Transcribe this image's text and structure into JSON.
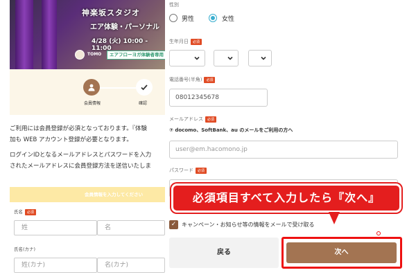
{
  "hero": {
    "studio": "神楽坂スタジオ",
    "kind": "エア体験・パーソナル",
    "when": "4/28 (火) 10:00 - 11:00",
    "instructor": "TOMO",
    "badge": "エアフローヨガ体験者専用"
  },
  "steps": [
    {
      "label": "会員情報",
      "icon": "person-icon"
    },
    {
      "label": "確認",
      "icon": "check-icon"
    }
  ],
  "intro": {
    "p1_line1": "ご利用には会員登録が必須となっております。『体験",
    "p1_line2": "加も WEB アカウント登録が必要となります。",
    "p2_line1": "ログインIDとなるメールアドレスとパスワードを入力",
    "p2_line2": "されたメールアドレスに会員登録方法を送信いたしま"
  },
  "left_form": {
    "section_title": "会員情報を入力してください",
    "name_label": "氏名",
    "required": "必須",
    "last_name_placeholder": "姓",
    "first_name_placeholder": "名",
    "kana_label": "氏名(カナ)",
    "last_kana_placeholder": "姓(カナ)",
    "first_kana_placeholder": "名(カナ)"
  },
  "form": {
    "gender_label": "性別",
    "gender_options": [
      {
        "label": "男性",
        "selected": false
      },
      {
        "label": "女性",
        "selected": true
      }
    ],
    "birth_label": "生年月日",
    "required": "必須",
    "phone_label": "電話番号(半角)",
    "phone_value": "08012345678",
    "email_label": "メールアドレス",
    "carrier_note": "⑦ docomo、SoftBank、au のメールをご利用の方へ",
    "email_placeholder": "user@em.hacomono.jp",
    "password_label": "パスワード",
    "newsletter_text": "キャンペーン・お知らせ等の情報をメールで受け取る",
    "newsletter_checked": true,
    "back_label": "戻る",
    "next_label": "次へ"
  },
  "callout": "必須項目すべて入力したら『次へ』",
  "colors": {
    "accent_brown": "#a37452",
    "required_red": "#e04b24",
    "highlight_red": "#e41e1e",
    "radio_blue": "#3aaecf"
  }
}
